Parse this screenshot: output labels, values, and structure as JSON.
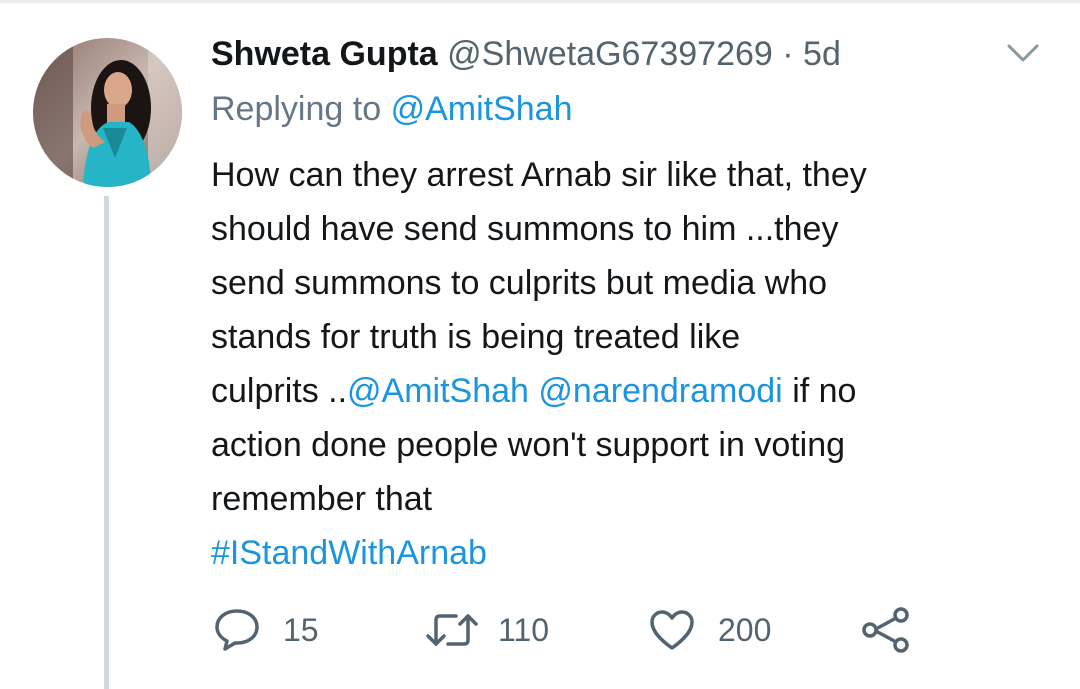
{
  "tweet": {
    "author_name": "Shweta Gupta",
    "handle": "@ShwetaG67397269",
    "separator": "·",
    "age": "5d",
    "replying_prefix": "Replying to",
    "replying_to": "@AmitShah",
    "body": {
      "line1": "How can they arrest Arnab sir like that, they",
      "line2": "should have send summons to him ...they",
      "line3": "send summons to culprits but media who",
      "line4": "stands for truth is being treated like",
      "line5_prefix": "culprits ..",
      "mention1": "@AmitShah",
      "mention2": "@narendramodi",
      "line5_suffix": "if no",
      "line6": "action done people won't support in voting",
      "line7": "remember that",
      "hashtag": "#IStandWithArnab"
    },
    "stats": {
      "replies": "15",
      "retweets": "110",
      "likes": "200"
    }
  },
  "icons": {
    "menu": "chevron-down-icon",
    "reply": "speech-bubble-icon",
    "retweet": "retweet-icon",
    "like": "heart-icon",
    "share": "share-icon"
  },
  "colors": {
    "link": "#1b95e0",
    "text": "#14171a",
    "secondary": "#657786",
    "thread_line": "#cfd9de"
  }
}
